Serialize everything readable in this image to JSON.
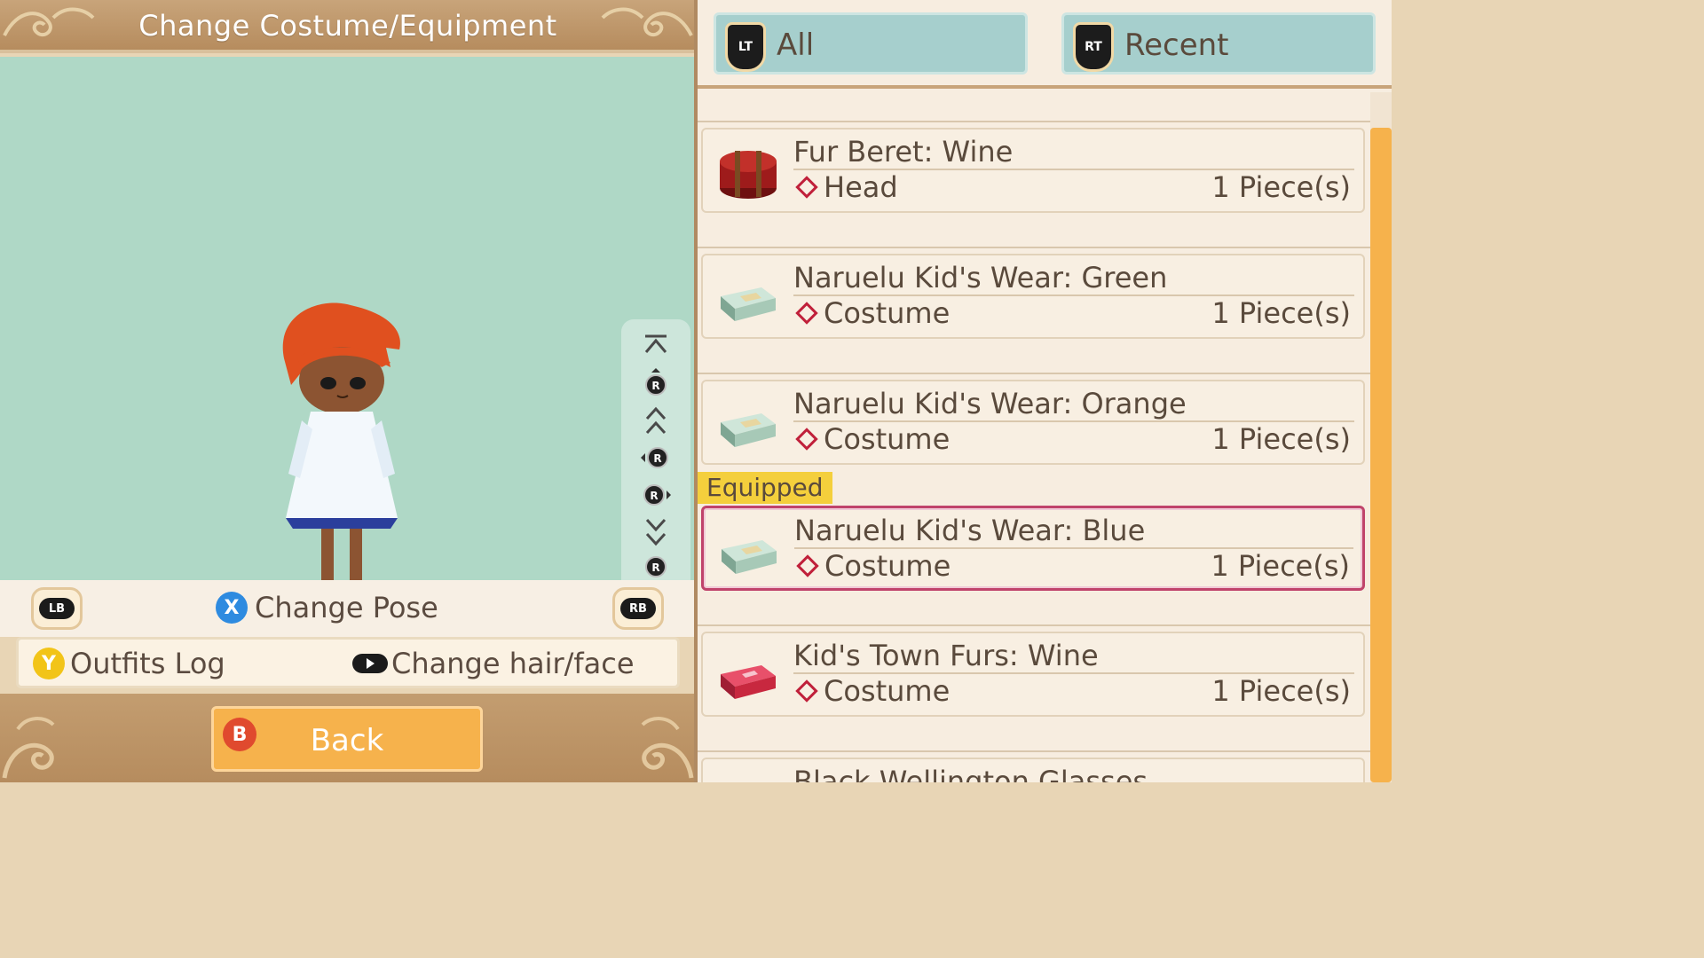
{
  "header": {
    "title": "Change Costume/Equipment"
  },
  "preview": {
    "camera_controls": [
      "scroll-top-icon",
      "rotate-up-icon",
      "zoom-in-icon",
      "rotate-left-icon",
      "rotate-right-icon",
      "zoom-out-icon",
      "rotate-down-icon",
      "scroll-bottom-icon"
    ]
  },
  "controls": {
    "lb_label": "LB",
    "rb_label": "RB",
    "change_pose_key": "X",
    "change_pose_label": "Change Pose",
    "outfits_log_key": "Y",
    "outfits_log_label": "Outfits Log",
    "change_hair_face_label": "Change hair/face"
  },
  "footer": {
    "back_key": "B",
    "back_label": "Back"
  },
  "tabs": [
    {
      "trigger": "LT",
      "label": "All"
    },
    {
      "trigger": "RT",
      "label": "Recent"
    }
  ],
  "equipped_label": "Equipped",
  "items": [
    {
      "name": "Fur Beret: Wine",
      "slot": "Head",
      "count": "1 Piece(s)",
      "icon": "hat-box-icon",
      "equipped": false
    },
    {
      "name": "Naruelu Kid's Wear: Green",
      "slot": "Costume",
      "count": "1 Piece(s)",
      "icon": "clothing-box-icon",
      "equipped": false
    },
    {
      "name": "Naruelu Kid's Wear: Orange",
      "slot": "Costume",
      "count": "1 Piece(s)",
      "icon": "clothing-box-icon",
      "equipped": false
    },
    {
      "name": "Naruelu Kid's Wear: Blue",
      "slot": "Costume",
      "count": "1 Piece(s)",
      "icon": "clothing-box-icon",
      "equipped": true
    },
    {
      "name": "Kid's Town Furs: Wine",
      "slot": "Costume",
      "count": "1 Piece(s)",
      "icon": "gift-box-icon",
      "equipped": false
    },
    {
      "name": "Black Wellington Glasses",
      "slot": "",
      "count": "",
      "icon": "",
      "equipped": false
    }
  ],
  "colors": {
    "accent_orange": "#f6b24c",
    "equipped_border": "#c0436b",
    "equipped_tag": "#f4cf3c",
    "preview_bg": "#afd8c6",
    "tab_bg": "#a6cfcd"
  }
}
